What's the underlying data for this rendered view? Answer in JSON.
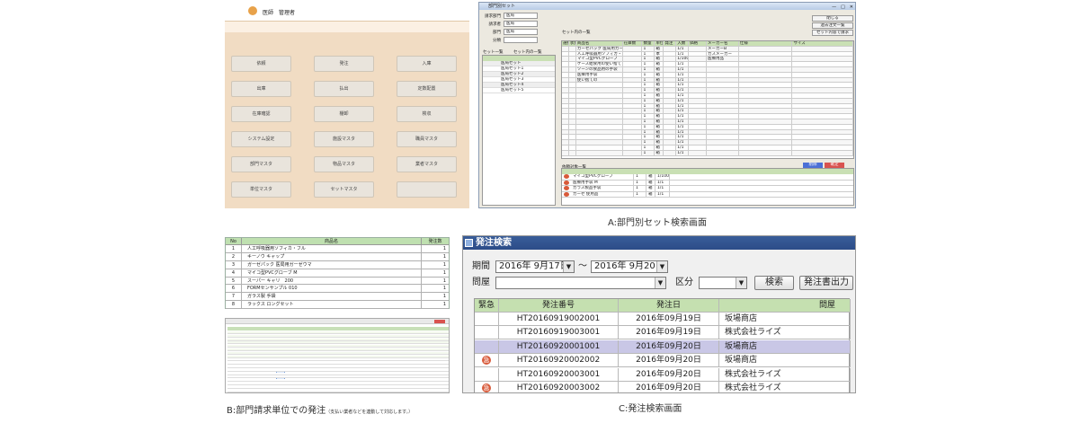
{
  "panel_menu": {
    "user": "医師　管理者",
    "buttons": [
      "依頼",
      "発注",
      "入庫",
      "出庫",
      "払出",
      "定数配置",
      "在庫確認",
      "棚卸",
      "検収",
      "システム設定",
      "施設マスタ",
      "職員マスタ",
      "部門マスタ",
      "物品マスタ",
      "業者マスタ",
      "単位マスタ",
      "セットマスタ",
      ""
    ]
  },
  "panel_set": {
    "window_title": "部門別セット",
    "fields": [
      {
        "label": "請求部門",
        "value": "医局"
      },
      {
        "label": "請求者",
        "value": "医局"
      },
      {
        "label": "部門",
        "value": "医局"
      },
      {
        "label": "分類",
        "value": ""
      }
    ],
    "buttons": [
      "閉じる",
      "過去注文一覧",
      "セット内容で請求"
    ],
    "set_list_title": "セット一覧",
    "set_list_label": "セット内の一覧",
    "set_list_items": [
      "医局セット",
      "医局セット1",
      "医局セット2",
      "医局セット3",
      "医局セット4",
      "医局セット5"
    ],
    "grid_headers": [
      "選択",
      "状態",
      "商品名",
      "在庫数",
      "数量",
      "単位",
      "発注",
      "入数",
      "価格",
      "メーカー名",
      "仕様",
      "サイズ"
    ],
    "grid_rows": [
      [
        "",
        "",
        "ガーゼパック 医局用ガーゼウマ",
        "",
        "1",
        "箱",
        "",
        "1/1",
        "",
        "メーカーB",
        "",
        ""
      ],
      [
        "",
        "",
        "人工呼吸器用ソフィカ・フル",
        "",
        "1",
        "本",
        "",
        "1/1",
        "",
        "ガスメーカー",
        "",
        ""
      ],
      [
        "",
        "",
        "マイコ型PVCグローブ",
        "",
        "1",
        "箱",
        "",
        "1/100",
        "",
        "医療用品",
        "",
        ""
      ],
      [
        "",
        "",
        "ケース給食用の使い捨て",
        "",
        "1",
        "箱",
        "",
        "1/1",
        "",
        "",
        "",
        ""
      ],
      [
        "",
        "",
        "ゾーンの食品用の手袋",
        "",
        "1",
        "箱",
        "",
        "1/1",
        "",
        "",
        "",
        ""
      ],
      [
        "",
        "",
        "医療用手袋",
        "",
        "1",
        "箱",
        "",
        "1/1",
        "",
        "",
        "",
        ""
      ],
      [
        "",
        "",
        "使い捨ての",
        "",
        "1",
        "箱",
        "",
        "1/1",
        "",
        "",
        "",
        ""
      ],
      [
        "",
        "",
        "",
        "",
        "1",
        "箱",
        "",
        "1/1",
        "",
        "",
        "",
        ""
      ],
      [
        "",
        "",
        "",
        "",
        "1",
        "箱",
        "",
        "1/1",
        "",
        "",
        "",
        ""
      ],
      [
        "",
        "",
        "",
        "",
        "1",
        "箱",
        "",
        "1/1",
        "",
        "",
        "",
        ""
      ],
      [
        "",
        "",
        "",
        "",
        "1",
        "箱",
        "",
        "1/1",
        "",
        "",
        "",
        ""
      ],
      [
        "",
        "",
        "",
        "",
        "1",
        "箱",
        "",
        "1/1",
        "",
        "",
        "",
        ""
      ],
      [
        "",
        "",
        "",
        "",
        "1",
        "箱",
        "",
        "1/1",
        "",
        "",
        "",
        ""
      ],
      [
        "",
        "",
        "",
        "",
        "1",
        "箱",
        "",
        "1/1",
        "",
        "",
        "",
        ""
      ],
      [
        "",
        "",
        "",
        "",
        "1",
        "箱",
        "",
        "1/1",
        "",
        "",
        "",
        ""
      ],
      [
        "",
        "",
        "",
        "",
        "1",
        "箱",
        "",
        "1/1",
        "",
        "",
        "",
        ""
      ],
      [
        "",
        "",
        "",
        "",
        "1",
        "箱",
        "",
        "1/1",
        "",
        "",
        "",
        ""
      ],
      [
        "",
        "",
        "",
        "",
        "1",
        "箱",
        "",
        "1/1",
        "",
        "",
        "",
        ""
      ],
      [
        "",
        "",
        "",
        "",
        "1",
        "箱",
        "",
        "1/1",
        "",
        "",
        "",
        ""
      ],
      [
        "",
        "",
        "",
        "",
        "1",
        "箱",
        "",
        "1/1",
        "",
        "",
        "",
        ""
      ],
      [
        "",
        "",
        "",
        "",
        "1",
        "箱",
        "",
        "1/1",
        "",
        "",
        "",
        ""
      ]
    ],
    "lower_title": "依頼対象一覧",
    "lower_buttons": [
      "削除",
      "確定"
    ],
    "lower_rows": [
      [
        "マイコ型PVCグローブ",
        "1",
        "箱",
        "1/100"
      ],
      [
        "医療用手袋 M",
        "1",
        "箱",
        "1/1"
      ],
      [
        "ガラス製品手袋",
        "1",
        "箱",
        "1/1"
      ],
      [
        "ガーゼ 使用品",
        "1",
        "箱",
        "1/1"
      ]
    ]
  },
  "panel_list": {
    "headers": [
      "No",
      "商品名",
      "発注数"
    ],
    "rows": [
      [
        "1",
        "人工呼吸器用ソフィカ・フル",
        "1"
      ],
      [
        "2",
        "キーノウ キャップ",
        "1"
      ],
      [
        "3",
        "ガーゼパック 医局用ガーゼウマ",
        "1"
      ],
      [
        "4",
        "マイコ型PVCグローブ M",
        "1"
      ],
      [
        "5",
        "スーパー キャリ　200",
        "1"
      ],
      [
        "6",
        "FORMセンサンプル 010",
        "1"
      ],
      [
        "7",
        "ガラス製 手袋",
        "1"
      ],
      [
        "8",
        "ラックス ロングセット",
        "1"
      ]
    ]
  },
  "panel_order": {
    "title": "発注検索",
    "period_label": "期間",
    "date_from": "2016年  9月17日",
    "tilde": "～",
    "date_to": "2016年  9月20日",
    "vendor_label": "問屋",
    "vendor_value": "",
    "division_label": "区分",
    "division_value": "",
    "search_button": "検索",
    "print_button": "発注書出力",
    "headers": [
      "緊急",
      "発注番号",
      "発注日",
      "問屋"
    ],
    "rows": [
      {
        "urgent": "",
        "no": "HT20160919002001",
        "date": "2016年09月19日",
        "vendor": "坂場商店",
        "selected": false
      },
      {
        "urgent": "",
        "no": "HT20160919003001",
        "date": "2016年09月19日",
        "vendor": "株式会社ライズ",
        "selected": false
      },
      {
        "urgent": "",
        "no": "HT20160920001001",
        "date": "2016年09月20日",
        "vendor": "坂場商店",
        "selected": true
      },
      {
        "urgent": "急",
        "no": "HT20160920002002",
        "date": "2016年09月20日",
        "vendor": "坂場商店",
        "selected": false
      },
      {
        "urgent": "",
        "no": "HT20160920003001",
        "date": "2016年09月20日",
        "vendor": "株式会社ライズ",
        "selected": false
      },
      {
        "urgent": "急",
        "no": "HT20160920003002",
        "date": "2016年09月20日",
        "vendor": "株式会社ライズ",
        "selected": false
      }
    ]
  },
  "captions": {
    "a": "A:部門別セット検索画面",
    "b": "B:部門請求単位での発注",
    "b_note": "（支払い業者などを連動して対応します。）",
    "c": "C:発注検索画面"
  }
}
